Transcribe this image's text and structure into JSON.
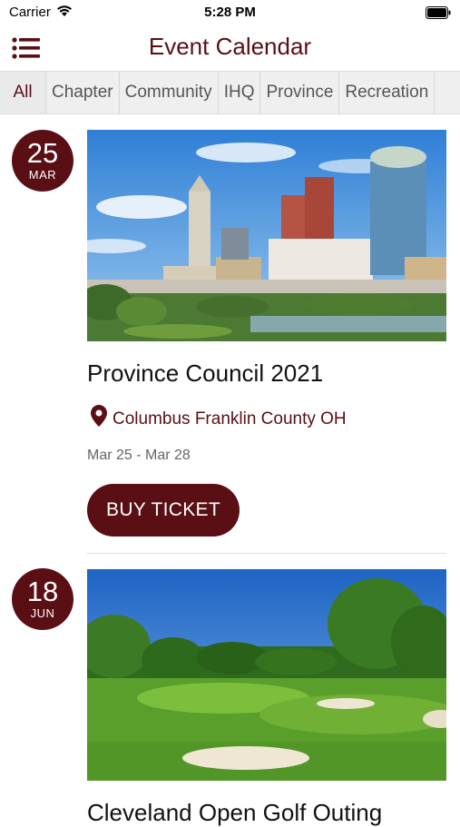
{
  "status_bar": {
    "carrier": "Carrier",
    "time": "5:28 PM"
  },
  "header": {
    "title": "Event Calendar",
    "menu_icon": "list-menu-icon"
  },
  "tabs": [
    {
      "label": "All",
      "active": true
    },
    {
      "label": "Chapter",
      "active": false
    },
    {
      "label": "Community",
      "active": false
    },
    {
      "label": "IHQ",
      "active": false
    },
    {
      "label": "Province",
      "active": false
    },
    {
      "label": "Recreation",
      "active": false
    }
  ],
  "events": [
    {
      "day": "25",
      "month": "MAR",
      "title": "Province Council 2021",
      "location": "Columbus Franklin County OH",
      "dates": "Mar 25 - Mar 28",
      "button_label": "BUY TICKET"
    },
    {
      "day": "18",
      "month": "JUN",
      "title": "Cleveland Open Golf Outing"
    }
  ],
  "colors": {
    "brand": "#5a0f14",
    "tab_bg": "#efefef"
  }
}
